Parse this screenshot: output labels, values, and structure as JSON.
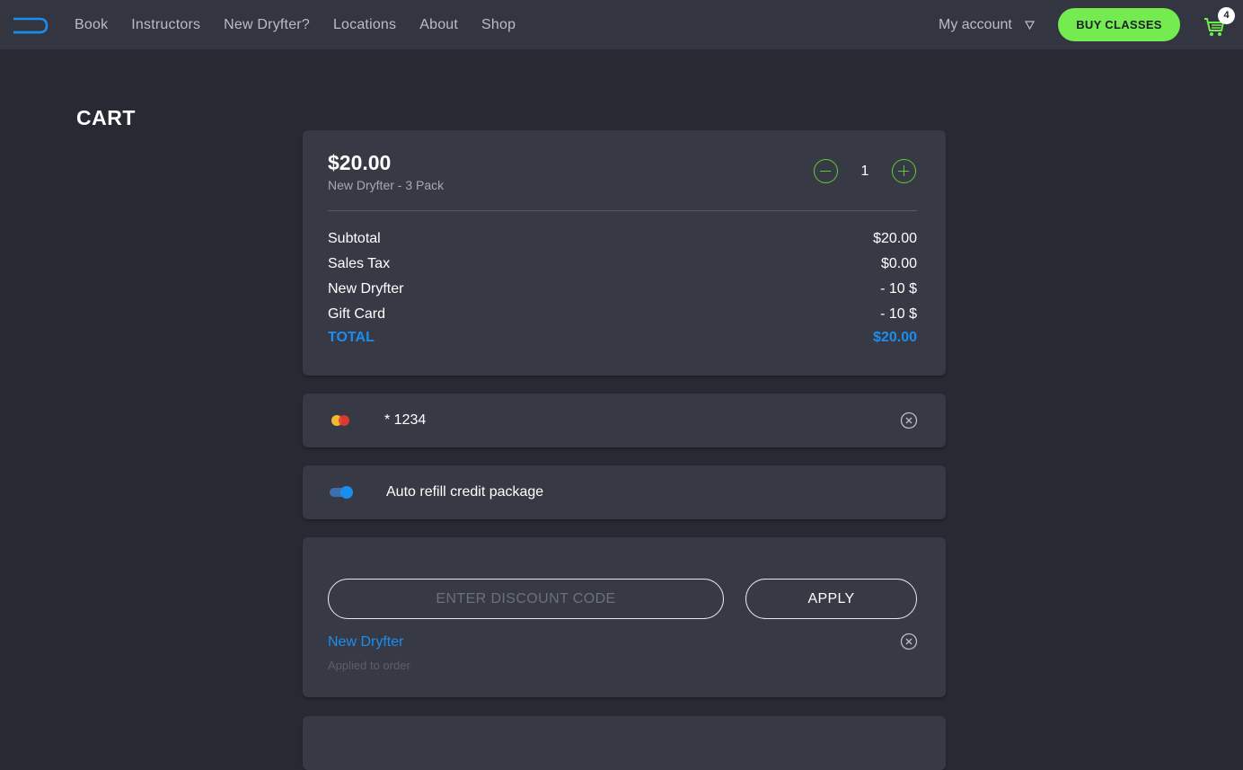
{
  "nav": {
    "items": [
      "Book",
      "Instructors",
      "New Dryfter?",
      "Locations",
      "About",
      "Shop"
    ],
    "account_label": "My account",
    "buy_label": "BUY CLASSES",
    "cart_count": "4"
  },
  "page": {
    "title": "CART"
  },
  "item": {
    "price": "$20.00",
    "name": "New Dryfter - 3 Pack",
    "quantity": "1"
  },
  "summary": {
    "subtotal_label": "Subtotal",
    "subtotal_value": "$20.00",
    "tax_label": "Sales Tax",
    "tax_value": "$0.00",
    "discount_label": "New Dryfter",
    "discount_value": "- 10 $",
    "giftcard_label": "Gift Card",
    "giftcard_value": "- 10 $",
    "total_label": "TOTAL",
    "total_value": "$20.00"
  },
  "payment": {
    "card_number": "* 1234"
  },
  "auto_refill": {
    "label": "Auto refill credit package",
    "enabled": true
  },
  "discount": {
    "placeholder": "ENTER DISCOUNT CODE",
    "apply_label": "APPLY",
    "applied_name": "New Dryfter",
    "applied_note": "Applied to order"
  },
  "colors": {
    "accent_green": "#74ec4f",
    "accent_blue": "#1a8ef0",
    "background": "#282a33",
    "card": "#373a45"
  }
}
